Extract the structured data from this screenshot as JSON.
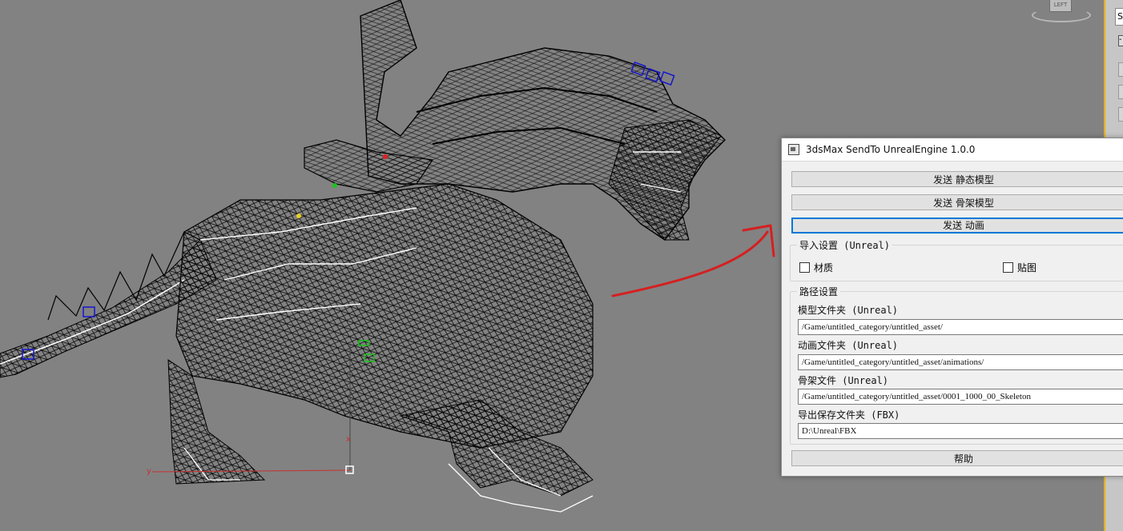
{
  "viewport": {
    "viewcube_label": "LEFT",
    "axis_x": "x",
    "axis_y": "y",
    "background_color": "#828282",
    "wireframe_color": "#000000"
  },
  "right_panel": {
    "field_text": "St",
    "collapse_symbol": "-"
  },
  "dialog": {
    "title": "3dsMax SendTo UnrealEngine 1.0.0",
    "buttons": {
      "static_mesh": "发送 静态模型",
      "skeletal_mesh": "发送 骨架模型",
      "animation": "发送 动画"
    },
    "import_settings": {
      "title": "导入设置 (Unreal)",
      "material_label": "材质",
      "material_checked": false,
      "texture_label": "贴图",
      "texture_checked": false
    },
    "path_settings": {
      "title": "路径设置",
      "model_folder_label": "模型文件夹 (Unreal)",
      "model_folder_value": "/Game/untitled_category/untitled_asset/",
      "anim_folder_label": "动画文件夹 (Unreal)",
      "anim_folder_value": "/Game/untitled_category/untitled_asset/animations/",
      "skeleton_file_label": "骨架文件 (Unreal)",
      "skeleton_file_value": "/Game/untitled_category/untitled_asset/0001_1000_00_Skeleton",
      "export_folder_label": "导出保存文件夹 (FBX)",
      "export_folder_value": "D:\\Unreal\\FBX"
    },
    "help_button": "帮助"
  },
  "colors": {
    "accent_focus": "#0078d7",
    "annotation_red": "#d42020"
  }
}
